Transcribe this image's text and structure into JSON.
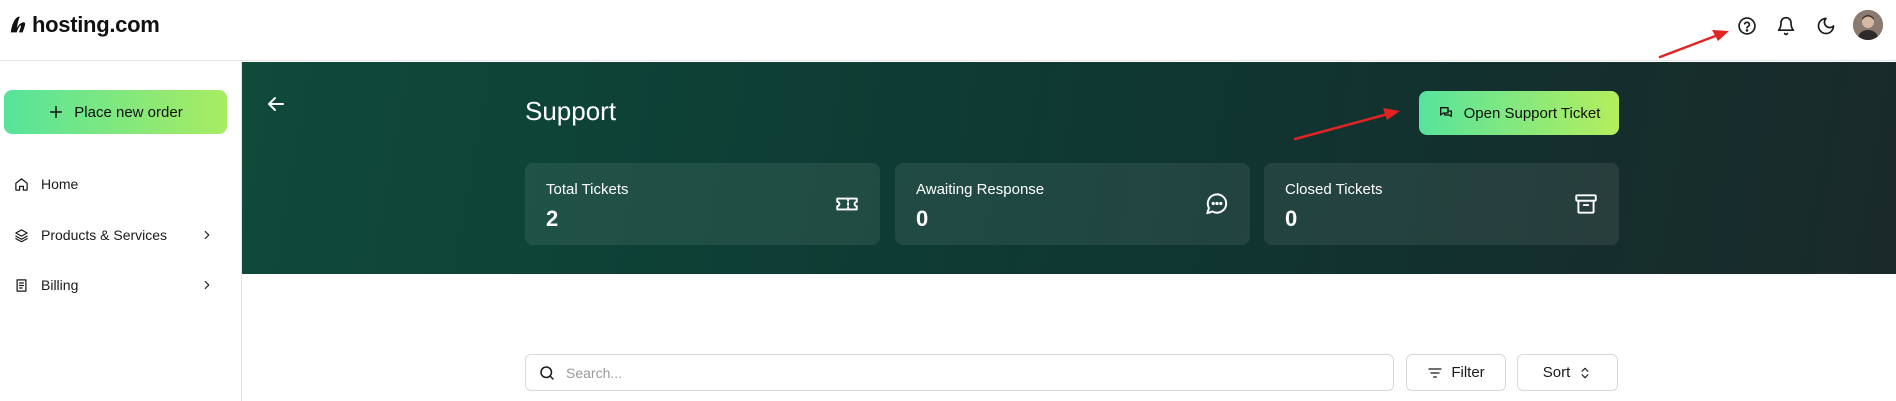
{
  "brand": {
    "name": "hosting.com"
  },
  "header": {
    "icons": [
      "help-circle-icon",
      "bell-icon",
      "moon-icon",
      "avatar"
    ]
  },
  "sidebar": {
    "new_order_label": "Place new order",
    "items": [
      {
        "label": "Home",
        "icon": "home-icon",
        "has_chevron": false
      },
      {
        "label": "Products & Services",
        "icon": "layers-icon",
        "has_chevron": true
      },
      {
        "label": "Billing",
        "icon": "document-icon",
        "has_chevron": true
      }
    ]
  },
  "hero": {
    "title": "Support",
    "open_ticket_label": "Open Support Ticket",
    "stats": [
      {
        "label": "Total Tickets",
        "value": "2",
        "icon": "ticket-icon"
      },
      {
        "label": "Awaiting Response",
        "value": "0",
        "icon": "message-circle-icon"
      },
      {
        "label": "Closed Tickets",
        "value": "0",
        "icon": "archive-icon"
      }
    ]
  },
  "toolbar": {
    "search_placeholder": "Search...",
    "filter_label": "Filter",
    "sort_label": "Sort"
  },
  "colors": {
    "accent_gradient_start": "#57e39c",
    "accent_gradient_end": "#a8ec62",
    "hero_bg": "#0e3a33",
    "annotation_arrow": "#e02424"
  }
}
